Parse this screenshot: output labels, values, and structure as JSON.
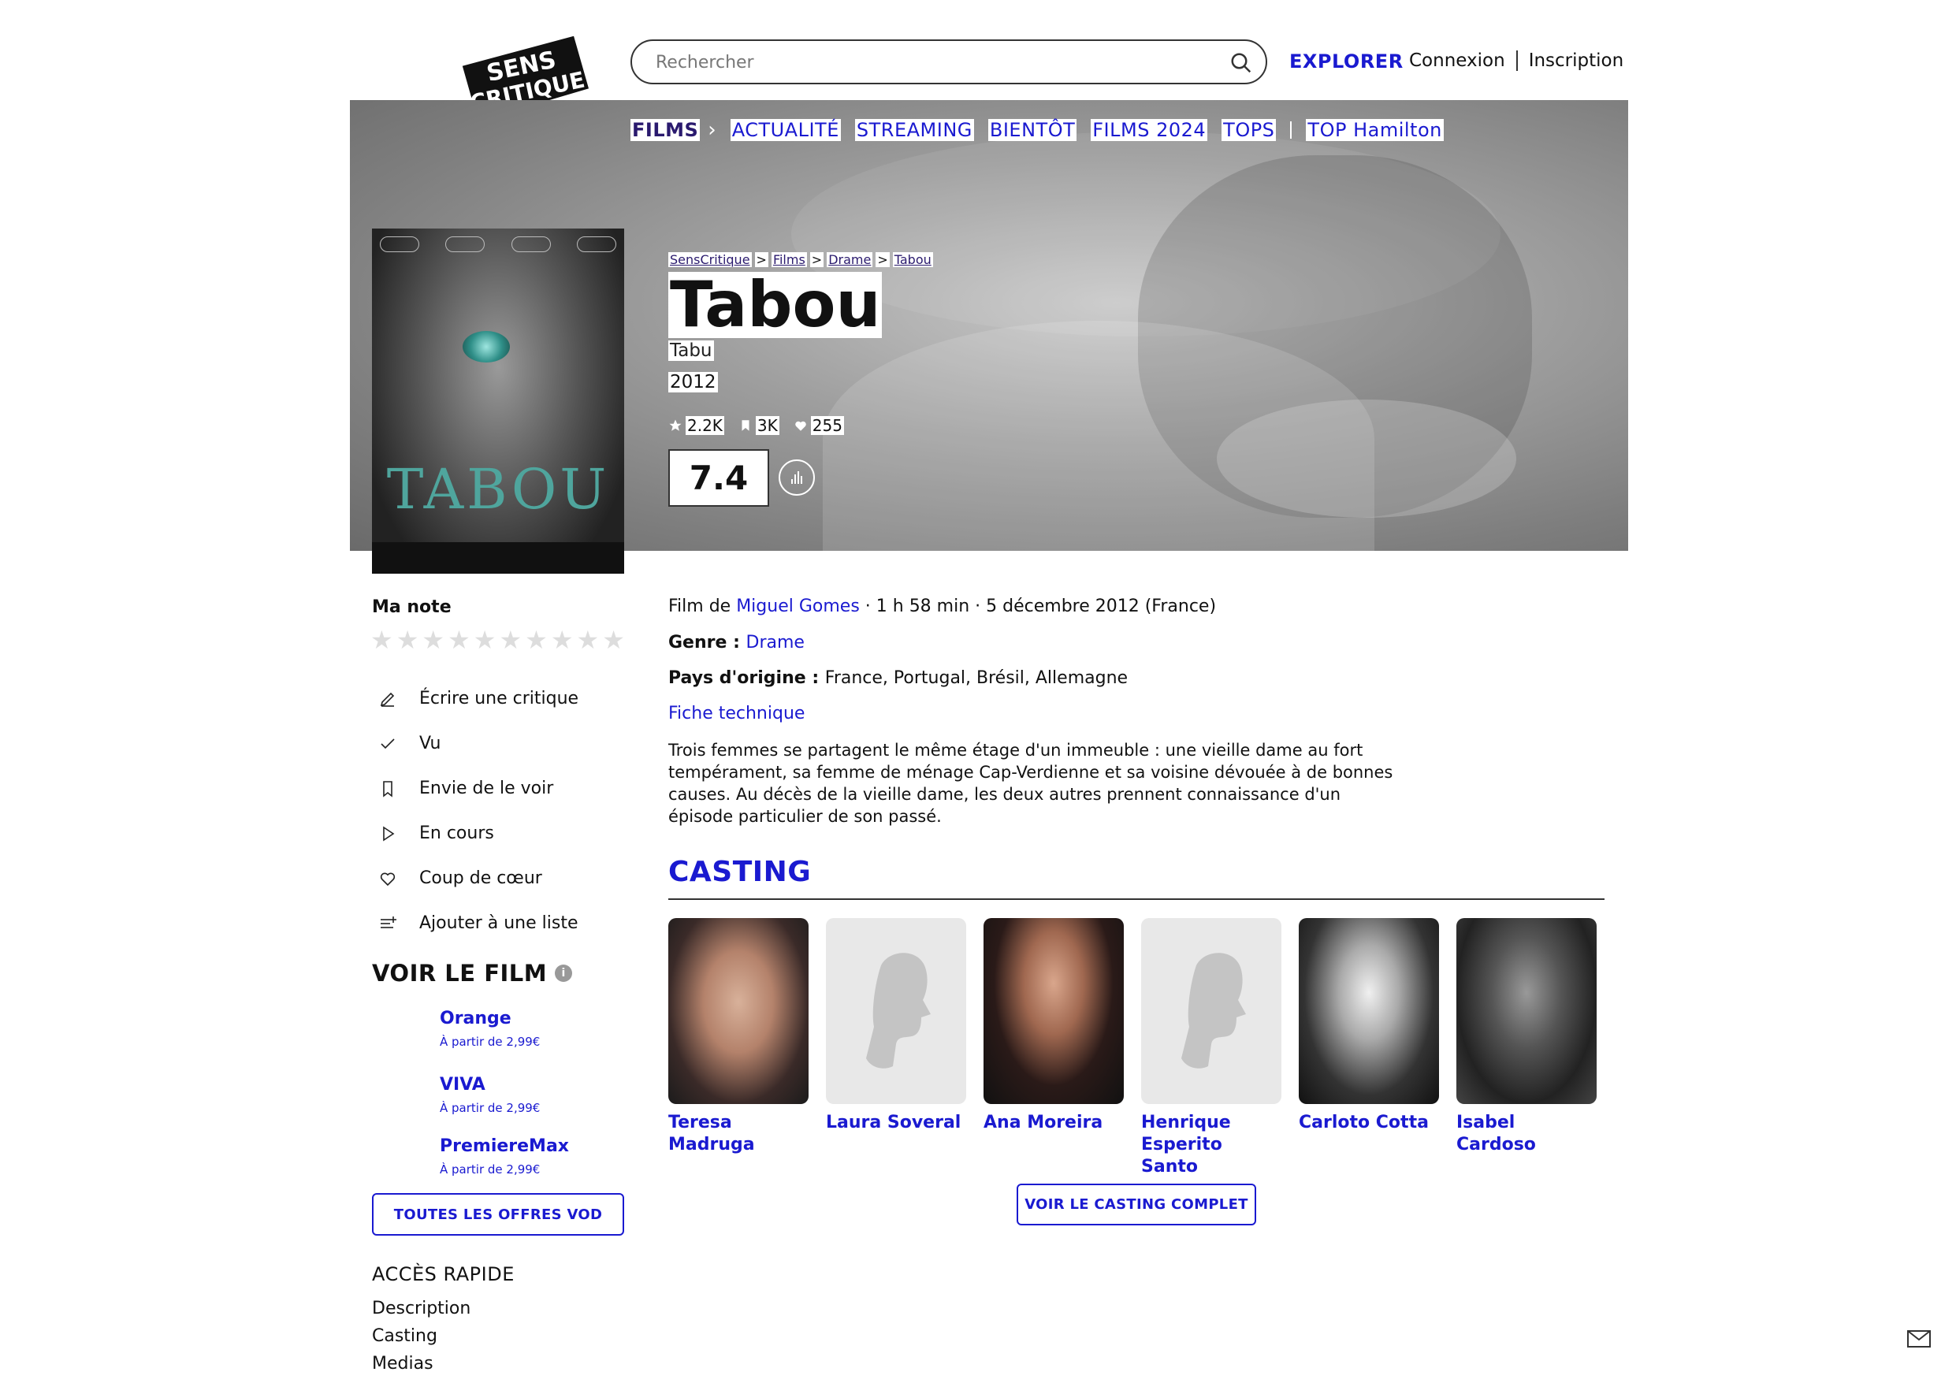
{
  "header": {
    "logo_text_1": "SENS",
    "logo_text_2": "CRITIQUE",
    "search_placeholder": "Rechercher",
    "explorer": "EXPLORER",
    "login": "Connexion",
    "signup": "Inscription"
  },
  "nav": {
    "items": [
      "FILMS",
      "ACTUALITÉ",
      "STREAMING",
      "BIENTÔT",
      "FILMS 2024",
      "TOPS",
      "TOP Hamilton"
    ]
  },
  "breadcrumb": [
    "SensCritique",
    "Films",
    "Drame",
    "Tabou"
  ],
  "breadcrumb_sep": ">",
  "movie": {
    "title": "Tabou",
    "original_title": "Tabu",
    "year": "2012",
    "ratings_count": "2.2K",
    "wishlist_count": "3K",
    "favorites_count": "255",
    "score": "7.4",
    "poster_title": "TABOU",
    "director_prefix": "Film de ",
    "director": "Miguel Gomes",
    "meta_suffix": " · 1 h 58 min · 5 décembre 2012 (France)",
    "genre_label": "Genre : ",
    "genre": "Drame",
    "countries_label": "Pays d'origine : ",
    "countries": "France, Portugal, Brésil, Allemagne",
    "fiche": "Fiche technique",
    "synopsis": "Trois femmes se partagent le même étage d'un immeuble : une vieille dame au fort tempérament, sa femme de ménage Cap-Verdienne et sa voisine dévouée à de bonnes causes. Au décès de la vieille dame, les deux autres prennent connaissance d'un épisode particulier de son passé."
  },
  "sidebar": {
    "my_rating": "Ma note",
    "actions": [
      {
        "label": "Écrire une critique",
        "icon": "pencil-icon"
      },
      {
        "label": "Vu",
        "icon": "check-icon"
      },
      {
        "label": "Envie de le voir",
        "icon": "bookmark-icon"
      },
      {
        "label": "En cours",
        "icon": "play-icon"
      },
      {
        "label": "Coup de cœur",
        "icon": "heart-icon"
      },
      {
        "label": "Ajouter à une liste",
        "icon": "list-add-icon"
      }
    ],
    "watch_title": "VOIR LE FILM",
    "vod": [
      {
        "name": "Orange",
        "price": "À partir de 2,99€"
      },
      {
        "name": "VIVA",
        "price": "À partir de 2,99€"
      },
      {
        "name": "PremiereMax",
        "price": "À partir de 2,99€"
      }
    ],
    "all_vod": "TOUTES LES OFFRES VOD",
    "quick_title": "ACCÈS RAPIDE",
    "quick_links": [
      "Description",
      "Casting",
      "Medias"
    ]
  },
  "casting": {
    "title": "CASTING",
    "actors": [
      {
        "line1": "Teresa Madruga",
        "line2": ""
      },
      {
        "line1": "Laura Soveral",
        "line2": ""
      },
      {
        "line1": "Ana Moreira",
        "line2": ""
      },
      {
        "line1": "Henrique",
        "line2": "Esperito Santo"
      },
      {
        "line1": "Carloto Cotta",
        "line2": ""
      },
      {
        "line1": "Isabel Cardoso",
        "line2": ""
      }
    ],
    "see_all": "VOIR LE CASTING COMPLET"
  },
  "colors": {
    "accent": "#1a1ad0",
    "nav_films": "#2a1a6e"
  }
}
